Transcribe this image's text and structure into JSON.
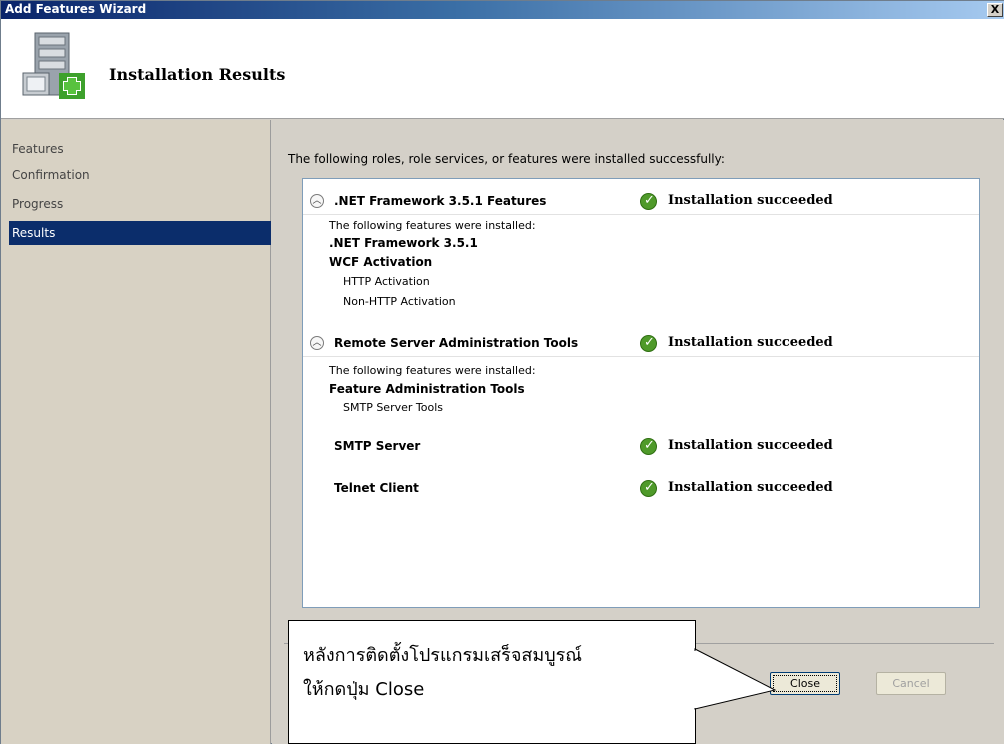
{
  "window": {
    "title": "Add Features Wizard",
    "close_glyph": "X"
  },
  "header": {
    "title": "Installation Results",
    "icon": "server-add-icon"
  },
  "sidebar": {
    "items": [
      {
        "label": "Features"
      },
      {
        "label": "Confirmation"
      },
      {
        "label": "Progress"
      },
      {
        "label": "Results"
      }
    ],
    "active_index": 3
  },
  "main": {
    "intro": "The following roles, role services, or features were installed successfully:",
    "features": [
      {
        "name": ".NET Framework 3.5.1 Features",
        "status": "Installation succeeded",
        "details_heading": "The following features were installed:",
        "details": [
          ".NET Framework 3.5.1",
          "WCF Activation",
          "HTTP Activation",
          "Non-HTTP Activation"
        ]
      },
      {
        "name": "Remote Server Administration Tools",
        "status": "Installation succeeded",
        "details_heading": "The following features were installed:",
        "details": [
          "Feature Administration Tools",
          "SMTP Server Tools"
        ]
      },
      {
        "name": "SMTP Server",
        "status": "Installation succeeded"
      },
      {
        "name": "Telnet Client",
        "status": "Installation succeeded"
      }
    ],
    "status_color": "#4f9a2a"
  },
  "buttons": {
    "close": "Close",
    "cancel": "Cancel"
  },
  "callout": {
    "line1": "หลังการติดตั้งโปรแกรมเสร็จสมบูรณ์",
    "line2": "ให้กดปุ่ม Close"
  }
}
